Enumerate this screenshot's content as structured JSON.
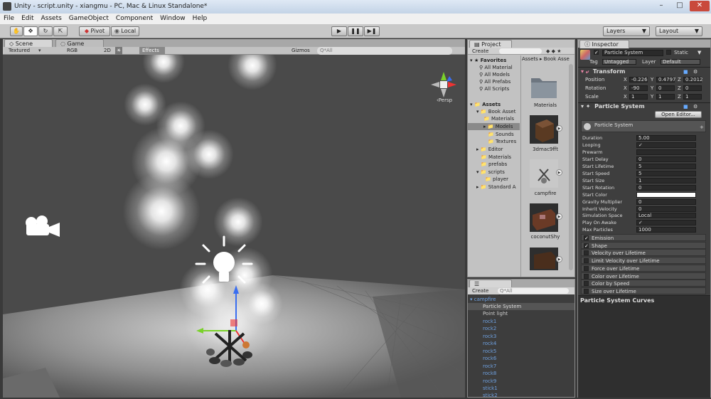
{
  "window": {
    "title": "Unity - script.unity - xiangmu - PC, Mac & Linux Standalone*"
  },
  "menu": [
    "File",
    "Edit",
    "Assets",
    "GameObject",
    "Component",
    "Window",
    "Help"
  ],
  "toolbar": {
    "pivot": "Pivot",
    "local": "Local",
    "layers": "Layers",
    "layout": "Layout"
  },
  "scene": {
    "tab_scene": "Scene",
    "tab_game": "Game",
    "shading": "Textured",
    "render": "RGB",
    "mode2d": "2D",
    "effects": "Effects",
    "gizmos": "Gizmos",
    "search_placeholder": "Q*All",
    "persp": "‹Persp"
  },
  "project": {
    "title": "Project",
    "create": "Create",
    "favorites": "Favorites",
    "fav_items": [
      "All Material",
      "All Models",
      "All Prefabs",
      "All Scripts"
    ],
    "assets": "Assets",
    "tree": [
      "Book Asset",
      "Materials",
      "Models",
      "Sounds",
      "Textures",
      "Editor",
      "Materials",
      "prefabs",
      "scripts",
      "player",
      "Standard A"
    ],
    "breadcrumb": "Assets ▸ Book Asse",
    "thumbs": [
      "Materials",
      "3dmac9fft",
      "campfire",
      "coconutShy",
      ""
    ]
  },
  "hierarchy": {
    "title": "Hierarchy",
    "create": "Create",
    "search_placeholder": "Q*All",
    "items": [
      "campfire",
      "Particle System",
      "Point light",
      "rock1",
      "rock2",
      "rock3",
      "rock4",
      "rock5",
      "rock6",
      "rock7",
      "rock8",
      "rock9",
      "stick1",
      "stick2"
    ]
  },
  "inspector": {
    "title": "Inspector",
    "object_name": "Particle System",
    "static": "Static",
    "tag_label": "Tag",
    "tag_value": "Untagged",
    "layer_label": "Layer",
    "layer_value": "Default",
    "transform": {
      "title": "Transform",
      "position_label": "Position",
      "rotation_label": "Rotation",
      "scale_label": "Scale",
      "position": {
        "x": "-0.226",
        "y": "0.4797",
        "z": "0.2012"
      },
      "rotation": {
        "x": "-90",
        "y": "0",
        "z": "0"
      },
      "scale": {
        "x": "1",
        "y": "1",
        "z": "1"
      }
    },
    "particle": {
      "title": "Particle System",
      "open_editor": "Open Editor...",
      "header": "Particle System",
      "props": [
        {
          "label": "Duration",
          "value": "5.00"
        },
        {
          "label": "Looping",
          "value": "✓"
        },
        {
          "label": "Prewarm",
          "value": ""
        },
        {
          "label": "Start Delay",
          "value": "0"
        },
        {
          "label": "Start Lifetime",
          "value": "5"
        },
        {
          "label": "Start Speed",
          "value": "5"
        },
        {
          "label": "Start Size",
          "value": "1"
        },
        {
          "label": "Start Rotation",
          "value": "0"
        },
        {
          "label": "Start Color",
          "value": ""
        },
        {
          "label": "Gravity Multiplier",
          "value": "0"
        },
        {
          "label": "Inherit Velocity",
          "value": "0"
        },
        {
          "label": "Simulation Space",
          "value": "Local"
        },
        {
          "label": "Play On Awake",
          "value": "✓"
        },
        {
          "label": "Max Particles",
          "value": "1000"
        }
      ],
      "modules": [
        {
          "label": "Emission",
          "checked": "✓"
        },
        {
          "label": "Shape",
          "checked": "✓"
        },
        {
          "label": "Velocity over Lifetime",
          "checked": ""
        },
        {
          "label": "Limit Velocity over Lifetime",
          "checked": ""
        },
        {
          "label": "Force over Lifetime",
          "checked": ""
        },
        {
          "label": "Color over Lifetime",
          "checked": ""
        },
        {
          "label": "Color by Speed",
          "checked": ""
        },
        {
          "label": "Size over Lifetime",
          "checked": ""
        }
      ],
      "curves": "Particle System Curves"
    }
  }
}
